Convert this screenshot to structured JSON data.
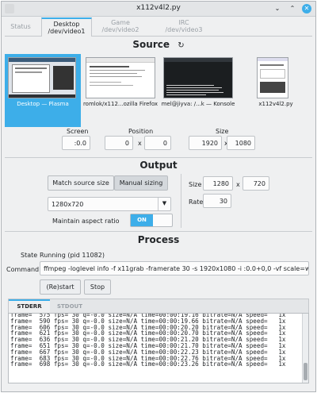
{
  "window": {
    "title": "x112v4l2.py"
  },
  "tabs": [
    {
      "label": "Status",
      "device": ""
    },
    {
      "label": "Desktop",
      "device": "/dev/video1"
    },
    {
      "label": "Game",
      "device": "/dev/video2"
    },
    {
      "label": "IRC",
      "device": "/dev/video3"
    }
  ],
  "source": {
    "title": "Source",
    "refresh_icon": "refresh-icon",
    "items": [
      {
        "label": "Desktop — Plasma"
      },
      {
        "label": "romlok/x112...ozilla Firefox"
      },
      {
        "label": "mel@jiyva: /...k — Konsole"
      },
      {
        "label": "x112v4l2.py"
      }
    ],
    "screen_label": "Screen",
    "screen_value": ":0.0",
    "position_label": "Position",
    "position_x": "0",
    "position_y": "0",
    "size_label": "Size",
    "size_w": "1920",
    "size_h": "1080",
    "x_sep": "x"
  },
  "output": {
    "title": "Output",
    "match_button": "Match source size",
    "manual_button": "Manual sizing",
    "resolution_value": "1280x720",
    "aspect_label": "Maintain aspect ratio",
    "aspect_toggle": "ON",
    "size_label": "Size",
    "size_w": "1280",
    "size_h": "720",
    "rate_label": "Rate",
    "rate_value": "30",
    "x_sep": "x"
  },
  "process": {
    "title": "Process",
    "state_label": "State",
    "state_value": "Running (pid 11082)",
    "command_label": "Command",
    "command_value": "ffmpeg -loglevel info -f x11grab -framerate 30 -s 1920x1080 -i :0.0+0,0 -vf scale=width=1280:heigh",
    "restart_button": "(Re)start",
    "stop_button": "Stop",
    "log_tabs": [
      "STDERR",
      "STDOUT"
    ],
    "log_lines": [
      "frame=  575 fps= 30 q=-0.0 size=N/A time=00:00:19.16 bitrate=N/A speed=   1x",
      "frame=  590 fps= 30 q=-0.0 size=N/A time=00:00:19.66 bitrate=N/A speed=   1x",
      "frame=  606 fps= 30 q=-0.0 size=N/A time=00:00:20.20 bitrate=N/A speed=   1x",
      "frame=  621 fps= 30 q=-0.0 size=N/A time=00:00:20.70 bitrate=N/A speed=   1x",
      "frame=  636 fps= 30 q=-0.0 size=N/A time=00:00:21.20 bitrate=N/A speed=   1x",
      "frame=  651 fps= 30 q=-0.0 size=N/A time=00:00:21.70 bitrate=N/A speed=   1x",
      "frame=  667 fps= 30 q=-0.0 size=N/A time=00:00:22.23 bitrate=N/A speed=   1x",
      "frame=  683 fps= 30 q=-0.0 size=N/A time=00:00:22.76 bitrate=N/A speed=   1x",
      "frame=  698 fps= 30 q=-0.0 size=N/A time=00:00:23.26 bitrate=N/A speed=   1x"
    ]
  },
  "colors": {
    "accent": "#3daee9",
    "window_bg": "#eff0f1",
    "toggle_on": "#3daee9"
  }
}
